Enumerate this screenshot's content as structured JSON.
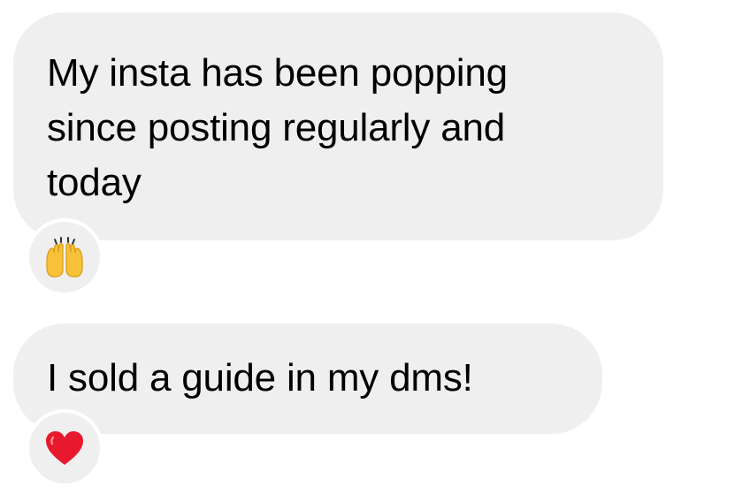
{
  "messages": [
    {
      "text": "My insta has been popping\nsince posting regularly and\ntoday",
      "reaction": "raising-hands-emoji"
    },
    {
      "text": "I sold a guide in my dms!",
      "reaction": "red-heart-emoji"
    }
  ],
  "colors": {
    "bubble": "#efefef",
    "background": "#ffffff",
    "text": "#000000",
    "heart": "#e8192c",
    "hands": "#f7c23a"
  }
}
